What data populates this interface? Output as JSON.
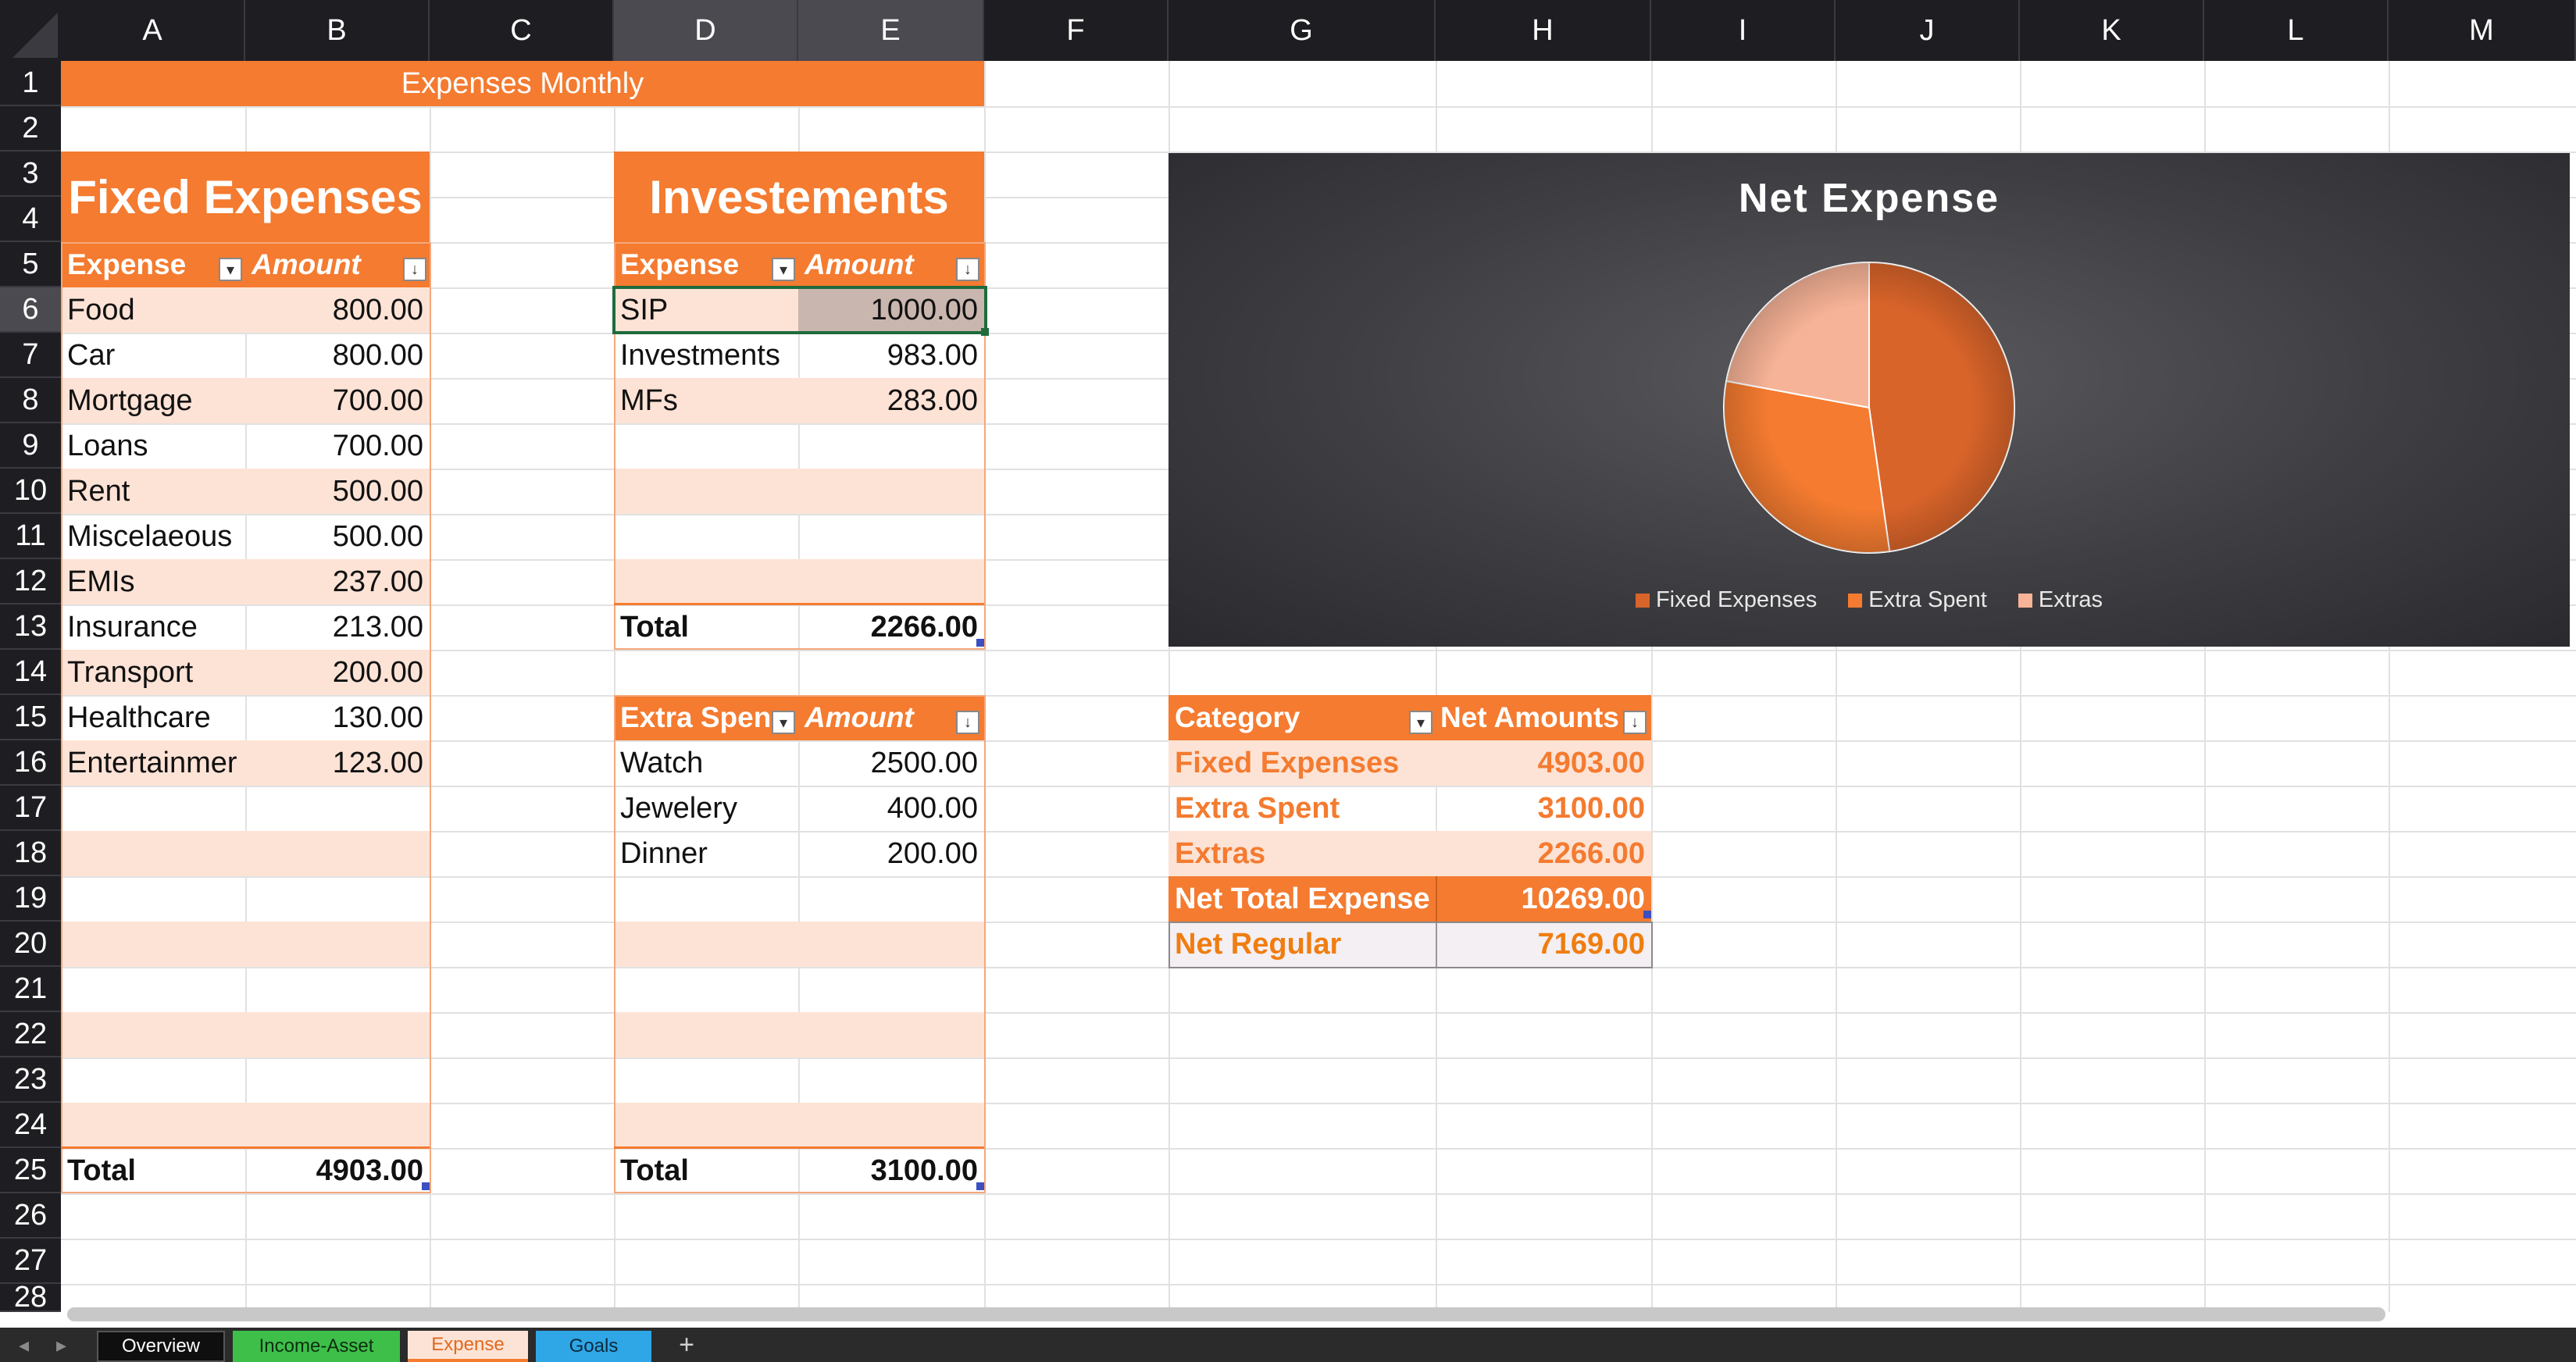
{
  "columns": [
    "A",
    "B",
    "C",
    "D",
    "E",
    "F",
    "G",
    "H",
    "I",
    "J",
    "K",
    "L",
    "M"
  ],
  "rows": [
    "1",
    "2",
    "3",
    "4",
    "5",
    "6",
    "7",
    "8",
    "9",
    "10",
    "11",
    "12",
    "13",
    "14",
    "15",
    "16",
    "17",
    "18",
    "19",
    "20",
    "21",
    "22",
    "23",
    "24",
    "25",
    "26",
    "27",
    "28"
  ],
  "sheet_title": "Expenses Monthly",
  "fixed": {
    "title": "Fixed Expenses",
    "col1": "Expense",
    "col2": "Amount",
    "items": [
      {
        "name": "Food",
        "amount": "800.00"
      },
      {
        "name": "Car",
        "amount": "800.00"
      },
      {
        "name": "Mortgage",
        "amount": "700.00"
      },
      {
        "name": "Loans",
        "amount": "700.00"
      },
      {
        "name": "Rent",
        "amount": "500.00"
      },
      {
        "name": "Miscelaeous",
        "amount": "500.00"
      },
      {
        "name": "EMIs",
        "amount": "237.00"
      },
      {
        "name": "Insurance",
        "amount": "213.00"
      },
      {
        "name": "Transport",
        "amount": "200.00"
      },
      {
        "name": "Healthcare",
        "amount": "130.00"
      },
      {
        "name": "Entertainmer",
        "amount": "123.00"
      }
    ],
    "total_label": "Total",
    "total": "4903.00"
  },
  "invest": {
    "title": "Investements",
    "col1": "Expense",
    "col2": "Amount",
    "items": [
      {
        "name": "SIP",
        "amount": "1000.00"
      },
      {
        "name": "Investments",
        "amount": "983.00"
      },
      {
        "name": "MFs",
        "amount": "283.00"
      }
    ],
    "total_label": "Total",
    "total": "2266.00"
  },
  "extra": {
    "col1": "Extra Spen",
    "col2": "Amount",
    "items": [
      {
        "name": "Watch",
        "amount": "2500.00"
      },
      {
        "name": "Jewelery",
        "amount": "400.00"
      },
      {
        "name": "Dinner",
        "amount": "200.00"
      }
    ],
    "total_label": "Total",
    "total": "3100.00"
  },
  "summary": {
    "col1": "Category",
    "col2": "Net Amounts",
    "rows": [
      {
        "name": "Fixed Expenses",
        "amount": "4903.00"
      },
      {
        "name": "Extra Spent",
        "amount": "3100.00"
      },
      {
        "name": "Extras",
        "amount": "2266.00"
      }
    ],
    "net_total_label": "Net Total Expense",
    "net_total": "10269.00",
    "net_regular_label": "Net Regular",
    "net_regular": "7169.00"
  },
  "chart_data": {
    "type": "pie",
    "title": "Net Expense",
    "categories": [
      "Fixed Expenses",
      "Extra Spent",
      "Extras"
    ],
    "values": [
      4903,
      3100,
      2266
    ],
    "colors": [
      "#d9642a",
      "#f47b30",
      "#f7b397"
    ],
    "legend_position": "bottom"
  },
  "tabs": {
    "overview": "Overview",
    "income": "Income-Asset",
    "expense": "Expense",
    "goals": "Goals",
    "add": "+"
  },
  "colors": {
    "accent": "#f47b30",
    "band": "#fde3d6",
    "tab_income": "#3dbf4a",
    "tab_goals": "#2fa6e6"
  }
}
